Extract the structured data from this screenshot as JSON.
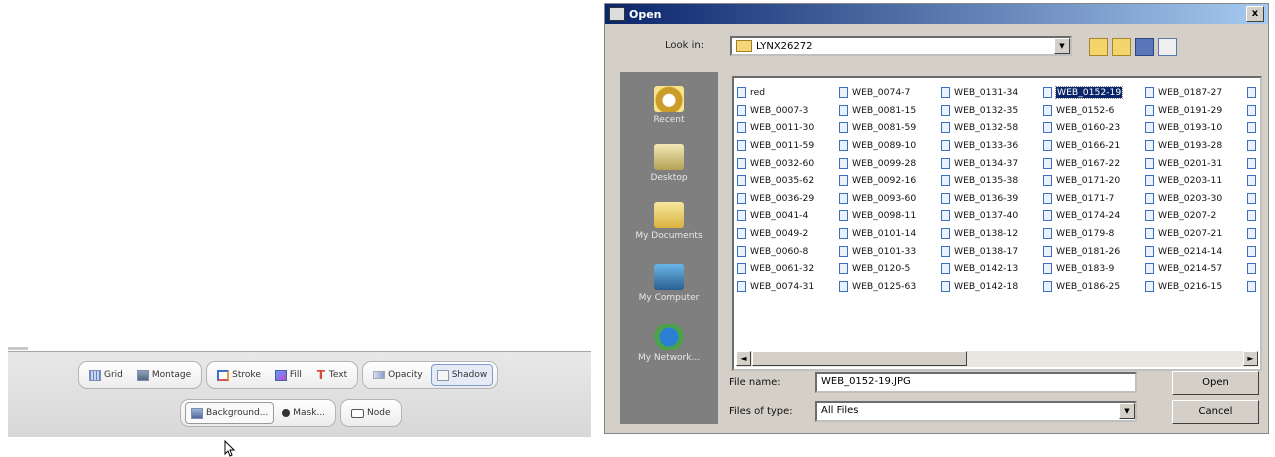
{
  "toolbar": {
    "row1": [
      {
        "label": "Grid",
        "icon": "grid-icon"
      },
      {
        "label": "Montage",
        "icon": "montage-icon"
      },
      {
        "label": "Stroke",
        "icon": "stroke-icon"
      },
      {
        "label": "Fill",
        "icon": "fill-icon"
      },
      {
        "label": "Text",
        "icon": "text-icon"
      },
      {
        "label": "Opacity",
        "icon": "opacity-icon"
      },
      {
        "label": "Shadow",
        "icon": "shadow-icon",
        "active": true
      }
    ],
    "row2": [
      {
        "label": "Background...",
        "icon": "background-icon"
      },
      {
        "label": "Mask...",
        "icon": "mask-icon"
      },
      {
        "label": "Node",
        "icon": "node-icon"
      }
    ]
  },
  "dialog": {
    "title": "Open",
    "close_glyph": "x",
    "lookin_label": "Look in:",
    "lookin_value": "LYNX26272",
    "places": [
      {
        "label": "Recent",
        "icon": "recent-icon"
      },
      {
        "label": "Desktop",
        "icon": "desktop-icon"
      },
      {
        "label": "My Documents",
        "icon": "my-documents-icon"
      },
      {
        "label": "My Computer",
        "icon": "my-computer-icon"
      },
      {
        "label": "My Network...",
        "icon": "my-network-icon"
      }
    ],
    "files": [
      [
        "red",
        "WEB_0074-7",
        "WEB_0131-34",
        "WEB_0152-19",
        "WEB_0187-27"
      ],
      [
        "WEB_0007-3",
        "WEB_0081-15",
        "WEB_0132-35",
        "WEB_0152-6",
        "WEB_0191-29"
      ],
      [
        "WEB_0011-30",
        "WEB_0081-59",
        "WEB_0132-58",
        "WEB_0160-23",
        "WEB_0193-10"
      ],
      [
        "WEB_0011-59",
        "WEB_0089-10",
        "WEB_0133-36",
        "WEB_0166-21",
        "WEB_0193-28"
      ],
      [
        "WEB_0032-60",
        "WEB_0099-28",
        "WEB_0134-37",
        "WEB_0167-22",
        "WEB_0201-31"
      ],
      [
        "WEB_0035-62",
        "WEB_0092-16",
        "WEB_0135-38",
        "WEB_0171-20",
        "WEB_0203-11"
      ],
      [
        "WEB_0036-29",
        "WEB_0093-60",
        "WEB_0136-39",
        "WEB_0171-7",
        "WEB_0203-30"
      ],
      [
        "WEB_0041-4",
        "WEB_0098-11",
        "WEB_0137-40",
        "WEB_0174-24",
        "WEB_0207-2"
      ],
      [
        "WEB_0049-2",
        "WEB_0101-14",
        "WEB_0138-12",
        "WEB_0179-8",
        "WEB_0207-21"
      ],
      [
        "WEB_0060-8",
        "WEB_0101-33",
        "WEB_0138-17",
        "WEB_0181-26",
        "WEB_0214-14"
      ],
      [
        "WEB_0061-32",
        "WEB_0120-5",
        "WEB_0142-13",
        "WEB_0183-9",
        "WEB_0214-57"
      ],
      [
        "WEB_0074-31",
        "WEB_0125-63",
        "WEB_0142-18",
        "WEB_0186-25",
        "WEB_0216-15"
      ]
    ],
    "selected_file": "WEB_0152-19",
    "filename_label": "File name:",
    "filename_value": "WEB_0152-19.JPG",
    "filetype_label": "Files of type:",
    "filetype_value": "All Files",
    "open_label": "Open",
    "cancel_label": "Cancel"
  }
}
